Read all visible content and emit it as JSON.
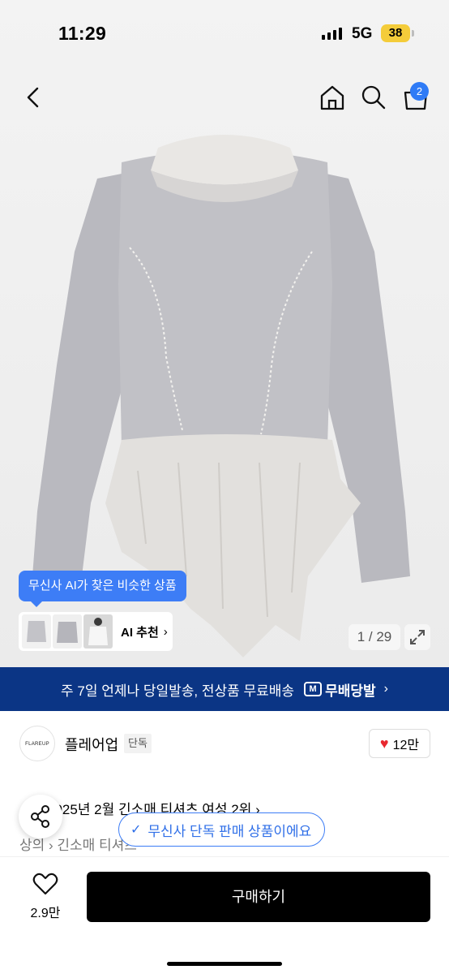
{
  "status_bar": {
    "time": "11:29",
    "network": "5G",
    "battery": "38"
  },
  "top_nav": {
    "cart_count": "2",
    "icons": [
      "chevron-left-icon",
      "home-icon",
      "search-icon",
      "cart-icon"
    ]
  },
  "hero": {
    "ai_tooltip": "무신사 AI가 찾은 비슷한 상품",
    "ai_recommend_label": "AI 추천",
    "image_counter": "1 / 29"
  },
  "banner": {
    "text": "주 7일 언제나 당일발송, 전상품 무료배송",
    "logo_mark": "M",
    "logo_text": "무배당발"
  },
  "brand": {
    "logo_text": "FLAREUP",
    "name": "플레어업",
    "tag": "단독",
    "like_count": "12만"
  },
  "ranking": {
    "text": "2025년 2월 긴소매 티셔츠 여성 2위"
  },
  "category": {
    "text": "상의 › 긴소매 티셔츠"
  },
  "toast": {
    "text": "무신사 단독 판매 상품이에요"
  },
  "bottom_bar": {
    "wish_count": "2.9만",
    "buy_label": "구매하기"
  },
  "colors": {
    "banner": "#0b3585",
    "accent": "#3d7df6",
    "buy_button": "#000000",
    "heart": "#e8282f"
  }
}
